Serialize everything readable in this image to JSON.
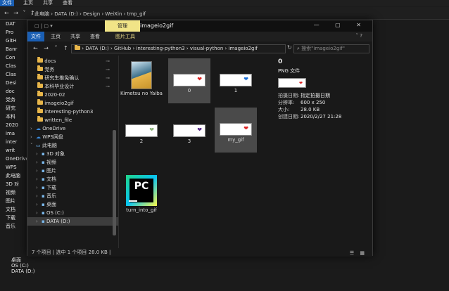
{
  "back_window": {
    "menu": [
      "文件",
      "主页",
      "共享",
      "查看"
    ],
    "nav_arrows": "← → ˅ ↑",
    "breadcrumb": "›  此电脑  ›  DATA (D:)  ›  Design  ›  WeiXin  ›  tmp_gif",
    "sidebar": [
      "DAT",
      "Pro",
      "GitH",
      "Banr",
      "Con",
      "Clas",
      "Clas",
      "Desi",
      "doc",
      "党务",
      "研究",
      "本科",
      "2020",
      "ima",
      "inter",
      "writ",
      "OneDrive",
      "WPS",
      "此电脑",
      "3D 对",
      "视频",
      "图片",
      "文档",
      "下载",
      "音乐"
    ],
    "bottom_items": [
      "桌面",
      "OS (C:)",
      "DATA (D:)"
    ]
  },
  "window": {
    "quick_access": "▢ | ▢ ▾",
    "context_tab": "管理",
    "title": "imageio2gif",
    "controls": "—  ▢  ✕",
    "ribbon_tabs": [
      "文件",
      "主页",
      "共享",
      "查看",
      "图片工具"
    ],
    "expand": "˅  ?",
    "nav_buttons": "← → ˅ ↑",
    "path": "›  DATA (D:)  ›  GitHub  ›  interesting-python3  ›  visual-python  ›  imageio2gif",
    "path_dropdown": "˅",
    "refresh": "↻",
    "search_placeholder": "搜索\"imageio2gif\"",
    "sidebar": [
      {
        "label": "docs",
        "type": "folder",
        "pinned": true
      },
      {
        "label": "党务",
        "type": "folder",
        "pinned": true
      },
      {
        "label": "研究生推免确认",
        "type": "folder",
        "pinned": true
      },
      {
        "label": "本科毕业设计",
        "type": "folder",
        "pinned": true
      },
      {
        "label": "2020-02",
        "type": "folder",
        "pinned": false
      },
      {
        "label": "imageio2gif",
        "type": "folder",
        "pinned": false
      },
      {
        "label": "interesting-python3",
        "type": "folder",
        "pinned": false
      },
      {
        "label": "written_file",
        "type": "folder",
        "pinned": false
      },
      {
        "label": "OneDrive",
        "type": "cloud",
        "pinned": false
      },
      {
        "label": "WPS网盘",
        "type": "cloud",
        "pinned": false
      },
      {
        "label": "此电脑",
        "type": "pc",
        "pinned": false
      },
      {
        "label": "3D 对象",
        "type": "sub",
        "pinned": false
      },
      {
        "label": "视频",
        "type": "sub",
        "pinned": false
      },
      {
        "label": "图片",
        "type": "sub",
        "pinned": false
      },
      {
        "label": "文档",
        "type": "sub",
        "pinned": false
      },
      {
        "label": "下载",
        "type": "sub",
        "pinned": false
      },
      {
        "label": "音乐",
        "type": "sub",
        "pinned": false
      },
      {
        "label": "桌面",
        "type": "sub",
        "pinned": false
      },
      {
        "label": "OS (C:)",
        "type": "sub",
        "pinned": false
      },
      {
        "label": "DATA (D:)",
        "type": "sub",
        "pinned": false,
        "selected": true
      }
    ],
    "files": [
      {
        "name": "Kimetsu no Yaiba",
        "kind": "folder"
      },
      {
        "name": "0",
        "kind": "thumb",
        "selected": true,
        "heart": "❤",
        "heart_color": "#d22"
      },
      {
        "name": "1",
        "kind": "thumb",
        "heart": "❤",
        "heart_color": "#1a6fd8"
      },
      {
        "name": "2",
        "kind": "thumb",
        "heart": "❤",
        "heart_color": "#8bb37a"
      },
      {
        "name": "3",
        "kind": "thumb",
        "heart": "❤",
        "heart_color": "#5a2c8a"
      },
      {
        "name": "my_gif",
        "kind": "thumb",
        "selected": true,
        "heart": "❤",
        "heart_color": "#d22"
      },
      {
        "name": "turn_into_gif",
        "kind": "pycharm",
        "logo_text": "PC"
      }
    ],
    "details": {
      "name": "0",
      "type": "PNG 文件",
      "rows": [
        {
          "k": "拍摄日期:",
          "v": "指定拍摄日期"
        },
        {
          "k": "分辨率:",
          "v": "600 x 250"
        },
        {
          "k": "大小:",
          "v": "28.0 KB"
        },
        {
          "k": "创建日期:",
          "v": "2020/2/27 21:28"
        }
      ]
    },
    "status": "7 个项目  |  选中 1 个项目  28.0 KB  |",
    "view_icons": "☰ ▦"
  }
}
